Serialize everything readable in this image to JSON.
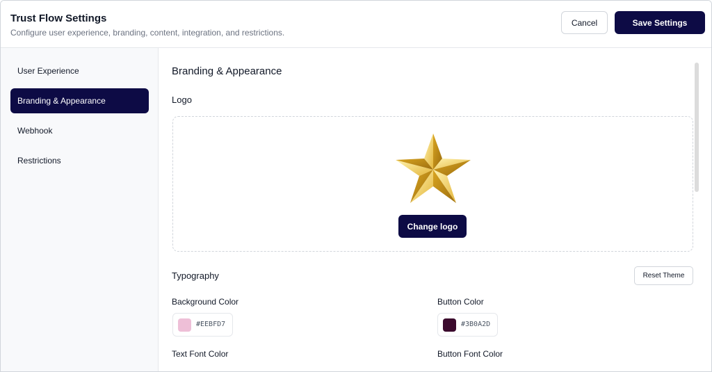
{
  "header": {
    "title": "Trust Flow Settings",
    "subtitle": "Configure user experience, branding, content, integration, and restrictions.",
    "cancel_label": "Cancel",
    "save_label": "Save Settings"
  },
  "sidebar": {
    "items": [
      {
        "label": "User Experience",
        "active": false
      },
      {
        "label": "Branding & Appearance",
        "active": true
      },
      {
        "label": "Webhook",
        "active": false
      },
      {
        "label": "Restrictions",
        "active": false
      }
    ]
  },
  "main": {
    "section_title": "Branding & Appearance",
    "logo": {
      "label": "Logo",
      "icon": "star-icon",
      "change_label": "Change logo"
    },
    "typography": {
      "title": "Typography",
      "reset_label": "Reset Theme",
      "fields": {
        "background_color": {
          "label": "Background Color",
          "value": "#EEBFD7"
        },
        "button_color": {
          "label": "Button Color",
          "value": "#3B0A2D"
        },
        "text_font_color": {
          "label": "Text Font Color"
        },
        "button_font_color": {
          "label": "Button Font Color"
        }
      }
    }
  },
  "colors": {
    "primary": "#0d0b45",
    "sidebar_bg": "#f8f9fb",
    "border": "#e5e7eb"
  }
}
